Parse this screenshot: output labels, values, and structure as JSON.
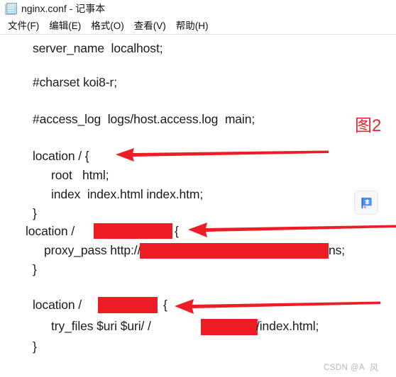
{
  "window": {
    "icon": "notepad-icon",
    "title": "nginx.conf - 记事本"
  },
  "menubar": {
    "items": [
      {
        "label": "文件(F)",
        "name": "menu-file"
      },
      {
        "label": "编辑(E)",
        "name": "menu-edit"
      },
      {
        "label": "格式(O)",
        "name": "menu-format"
      },
      {
        "label": "查看(V)",
        "name": "menu-view"
      },
      {
        "label": "帮助(H)",
        "name": "menu-help"
      }
    ]
  },
  "editor": {
    "lines": [
      {
        "text": "server_name  localhost;"
      },
      {
        "text": "#charset koi8-r;"
      },
      {
        "text": "#access_log  logs/host.access.log  main;"
      },
      {
        "text": "location / {"
      },
      {
        "text": "root   html;"
      },
      {
        "text": "index  index.html index.htm;"
      },
      {
        "text": "}"
      },
      {
        "text": "location /"
      },
      {
        "text": "{"
      },
      {
        "text": "proxy_pass http://"
      },
      {
        "text": "ns;"
      },
      {
        "text": "}"
      },
      {
        "text": "location /"
      },
      {
        "text": "{"
      },
      {
        "text": "try_files $uri $uri/ /"
      },
      {
        "text": "/index.html;"
      },
      {
        "text": "}"
      }
    ],
    "redactions": [
      {
        "name": "redaction-location-proxy-path"
      },
      {
        "name": "redaction-proxy-pass-url"
      },
      {
        "name": "redaction-location-spa-path"
      },
      {
        "name": "redaction-try-files-path"
      }
    ]
  },
  "annotations": {
    "color": "#ee1c24",
    "figure_label": "图2",
    "arrows": [
      {
        "name": "arrow-location-root",
        "direction": "left"
      },
      {
        "name": "arrow-location-proxy",
        "direction": "left"
      },
      {
        "name": "arrow-location-spa",
        "direction": "left"
      }
    ]
  },
  "float_widget": {
    "name": "book-icon",
    "accent": "#3b82f6"
  },
  "watermark": {
    "text": "CSDN @A",
    "glyph": "风"
  }
}
